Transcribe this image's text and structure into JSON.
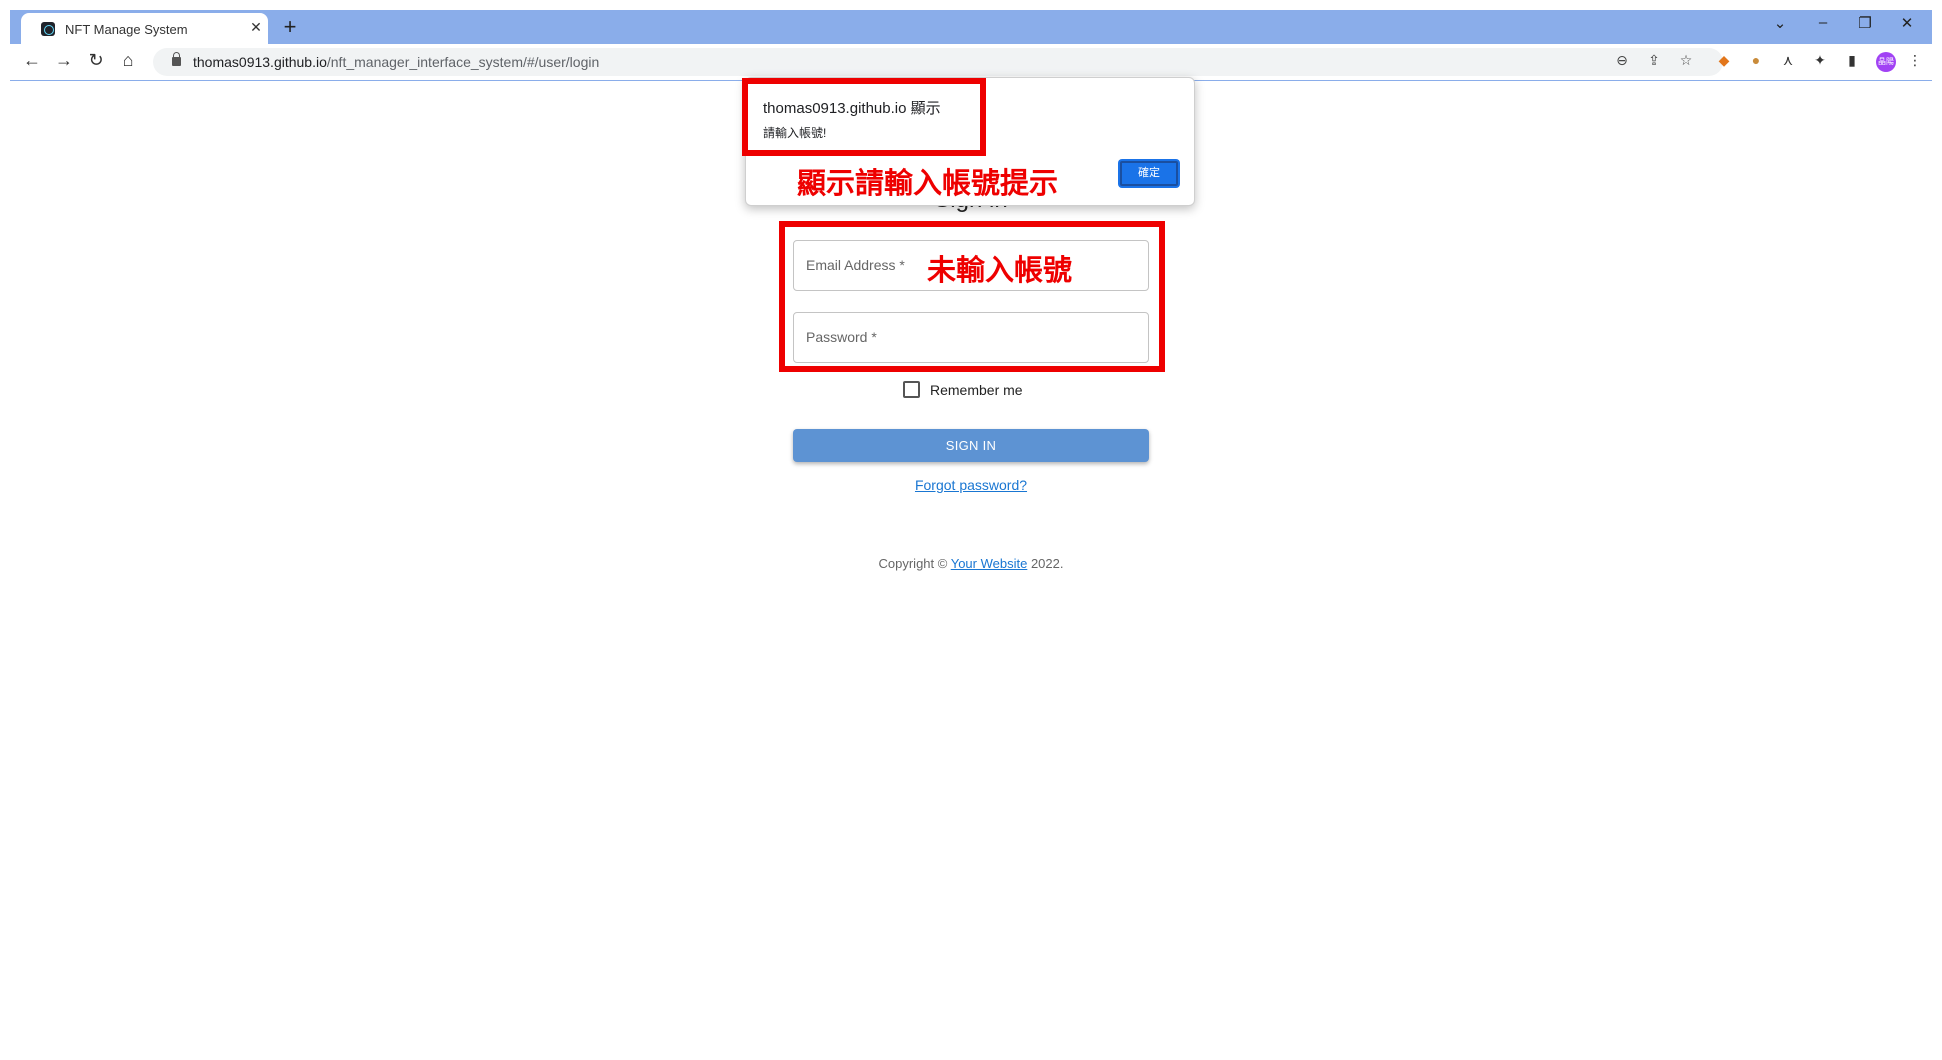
{
  "browser": {
    "tab": {
      "title": "NFT Manage System",
      "close": "✕"
    },
    "new_tab": "+",
    "window_controls": {
      "minimize": "–",
      "restore": "❐",
      "close": "✕",
      "tab_search": "⌄"
    },
    "nav": {
      "back": "←",
      "forward": "→",
      "reload": "↻",
      "home": "⌂"
    },
    "url": {
      "host": "thomas0913.github.io",
      "path": "/nft_manager_interface_system/#/user/login"
    },
    "avatar_text": "晶陽"
  },
  "dialog": {
    "origin": "thomas0913.github.io 顯示",
    "message": "請輸入帳號!",
    "ok_label": "確定"
  },
  "form": {
    "title": "Sign in",
    "email_placeholder": "Email Address *",
    "password_placeholder": "Password *",
    "remember_label": "Remember me",
    "signin_label": "SIGN IN",
    "forgot_label": "Forgot password?"
  },
  "footer": {
    "prefix": "Copyright © ",
    "link": "Your Website",
    "suffix": " 2022."
  },
  "annotations": {
    "dialog_note": "顯示請輸入帳號提示",
    "field_note": "未輸入帳號",
    "color": "#ee0000"
  }
}
